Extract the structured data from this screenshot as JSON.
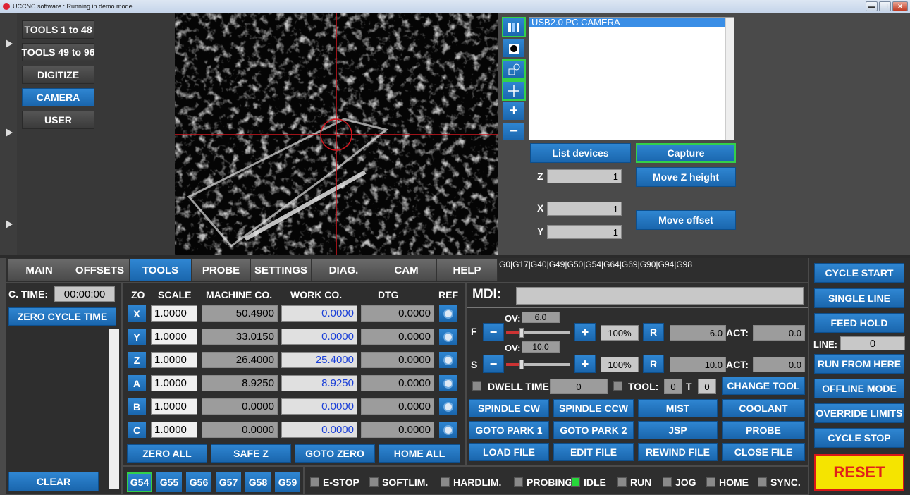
{
  "window": {
    "title": "UCCNC software : Running in demo mode...",
    "min": "▬",
    "max": "❐",
    "close": "✕"
  },
  "tool_pages": [
    "TOOLS 1 to 48",
    "TOOLS 49 to 96",
    "DIGITIZE",
    "CAMERA",
    "USER"
  ],
  "camera": {
    "device": "USB2.0 PC CAMERA",
    "list_devices": "List devices",
    "capture": "Capture",
    "z_label": "Z",
    "z_value": "1",
    "move_z": "Move Z height",
    "x_label": "X",
    "x_value": "1",
    "y_label": "Y",
    "y_value": "1",
    "move_offset": "Move offset"
  },
  "tabs": [
    "MAIN",
    "OFFSETS",
    "TOOLS",
    "PROBE",
    "SETTINGS",
    "DIAG.",
    "CAM",
    "HELP"
  ],
  "gcode_status": "G0|G17|G40|G49|G50|G54|G64|G69|G90|G94|G98",
  "cycle_time": {
    "label": "C. TIME:",
    "value": "00:00:00",
    "zero": "ZERO CYCLE TIME",
    "clear": "CLEAR"
  },
  "dro": {
    "headers": [
      "ZO",
      "SCALE",
      "MACHINE CO.",
      "WORK CO.",
      "DTG",
      "REF"
    ],
    "axes": [
      {
        "name": "X",
        "scale": "1.0000",
        "machine": "50.4900",
        "work": "0.0000",
        "dtg": "0.0000"
      },
      {
        "name": "Y",
        "scale": "1.0000",
        "machine": "33.0150",
        "work": "0.0000",
        "dtg": "0.0000"
      },
      {
        "name": "Z",
        "scale": "1.0000",
        "machine": "26.4000",
        "work": "25.4000",
        "dtg": "0.0000"
      },
      {
        "name": "A",
        "scale": "1.0000",
        "machine": "8.9250",
        "work": "8.9250",
        "dtg": "0.0000"
      },
      {
        "name": "B",
        "scale": "1.0000",
        "machine": "0.0000",
        "work": "0.0000",
        "dtg": "0.0000"
      },
      {
        "name": "C",
        "scale": "1.0000",
        "machine": "0.0000",
        "work": "0.0000",
        "dtg": "0.0000"
      }
    ],
    "zero_all": "ZERO ALL",
    "safe_z": "SAFE Z",
    "goto_zero": "GOTO ZERO",
    "home_all": "HOME ALL"
  },
  "work_offsets": [
    "G54",
    "G55",
    "G56",
    "G57",
    "G58",
    "G59"
  ],
  "mdi": {
    "label": "MDI:"
  },
  "feed": {
    "letter": "F",
    "ov_label": "OV:",
    "ov": "6.0",
    "pct": "100%",
    "r": "R",
    "value": "6.0",
    "act": "ACT:",
    "act_value": "0.0",
    "minus": "−",
    "plus": "+"
  },
  "spindle": {
    "letter": "S",
    "ov_label": "OV:",
    "ov": "10.0",
    "pct": "100%",
    "r": "R",
    "value": "10.0",
    "act": "ACT:",
    "act_value": "0.0",
    "minus": "−",
    "plus": "+"
  },
  "dwell": {
    "label": "DWELL TIME:",
    "value": "0",
    "tool_label": "TOOL:",
    "tool": "0",
    "t_label": "T",
    "t": "0",
    "change_tool": "CHANGE TOOL"
  },
  "actions": [
    [
      "SPINDLE CW",
      "SPINDLE CCW",
      "MIST",
      "COOLANT"
    ],
    [
      "GOTO PARK 1",
      "GOTO PARK 2",
      "JSP",
      "PROBE"
    ],
    [
      "LOAD FILE",
      "EDIT FILE",
      "REWIND FILE",
      "CLOSE FILE"
    ]
  ],
  "status_leds": [
    "E-STOP",
    "SOFTLIM.",
    "HARDLIM.",
    "PROBING",
    "IDLE",
    "RUN",
    "JOG",
    "HOME",
    "SYNC."
  ],
  "control": {
    "cycle_start": "CYCLE START",
    "single_line": "SINGLE LINE",
    "feed_hold": "FEED HOLD",
    "line_label": "LINE:",
    "line_value": "0",
    "run_from_here": "RUN FROM HERE",
    "offline_mode": "OFFLINE MODE",
    "override_limits": "OVERRIDE LIMITS",
    "cycle_stop": "CYCLE STOP",
    "reset": "RESET"
  },
  "colors": {
    "accent": "#1f74c0",
    "active_led": "#27d83a",
    "reset_bg": "#f5e400",
    "reset_text": "#e0201a",
    "work_coord": "#1a3fd8"
  }
}
